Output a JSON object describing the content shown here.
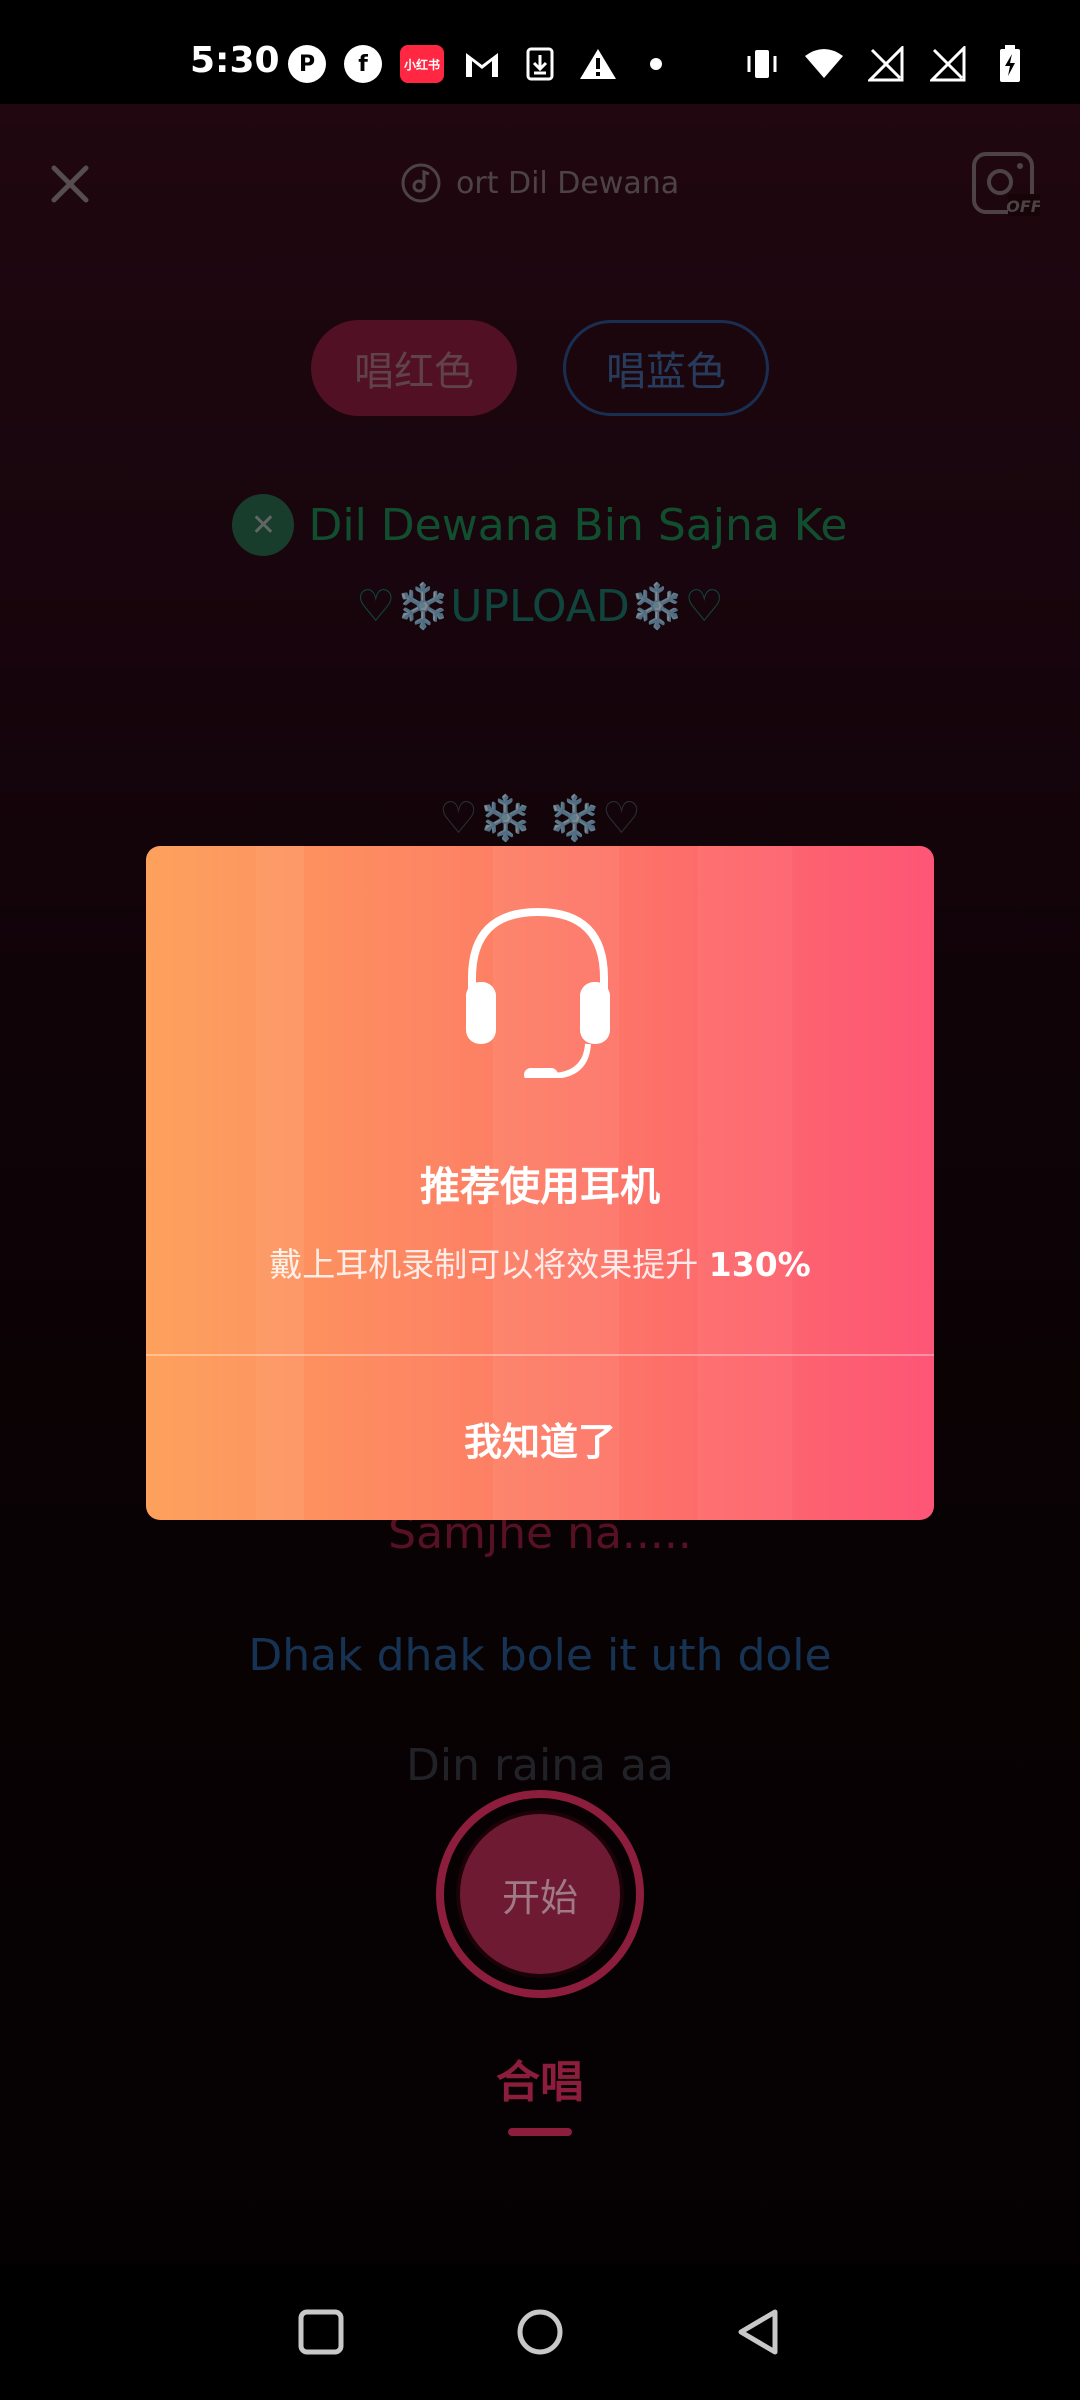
{
  "status_bar": {
    "time": "5:30",
    "left_icons": [
      "podcast-icon",
      "facebook-icon",
      "xiaohongshu-icon",
      "gmail-icon",
      "download-icon",
      "warning-icon",
      "dot-icon"
    ],
    "xiaohongshu_label": "小红书",
    "right_icons": [
      "vibrate-icon",
      "wifi-icon",
      "signal-off-icon",
      "signal-off-icon",
      "battery-charging-icon"
    ]
  },
  "header": {
    "song_title": "ort Dil Dewana",
    "camera_label": "OFF"
  },
  "parts": {
    "red_label": "唱红色",
    "blue_label": "唱蓝色"
  },
  "song": {
    "singer_line": "Dil Dewana Bin Sajna Ke",
    "upload_line": "♡❄️UPLOAD❄️♡",
    "snow_line": "♡❄️ ❄️♡"
  },
  "lyrics": {
    "red_line": "Samjhe na.....",
    "blue_line": "Dhak dhak bole it uth dole",
    "next_line": "Din raina aa"
  },
  "controls": {
    "start_label": "开始",
    "mode_label": "合唱"
  },
  "dialog": {
    "title": "推荐使用耳机",
    "subtitle_prefix": "戴上耳机录制可以将效果提升 ",
    "subtitle_value": "130%",
    "confirm_label": "我知道了"
  },
  "colors": {
    "dialog_gradient_start": "#fd9e57",
    "dialog_gradient_end": "#fd5576",
    "red_part": "#b52550",
    "blue_part": "#2d6fbf"
  }
}
